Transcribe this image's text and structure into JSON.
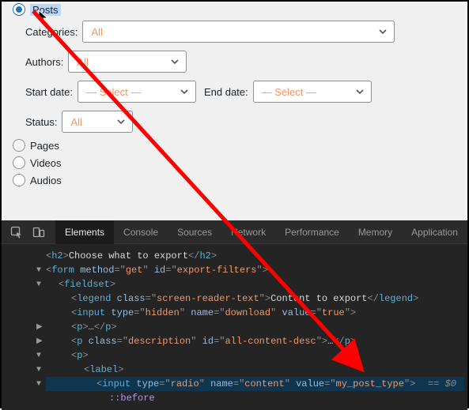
{
  "form": {
    "posts_label": "Posts",
    "categories_label": "Categories:",
    "categories_value": "All",
    "authors_label": "Authors:",
    "authors_value": "All",
    "startdate_label": "Start date:",
    "startdate_value": "— Select —",
    "enddate_label": "End date:",
    "enddate_value": "— Select —",
    "status_label": "Status:",
    "status_value": "All",
    "pages_label": "Pages",
    "videos_label": "Videos",
    "audios_label": "Audios"
  },
  "devtools": {
    "tabs": {
      "elements": "Elements",
      "console": "Console",
      "sources": "Sources",
      "network": "Network",
      "performance": "Performance",
      "memory": "Memory",
      "application": "Application"
    },
    "dom": {
      "h2_text": "Choose what to export",
      "form_method": "get",
      "form_id": "export-filters",
      "legend_class": "screen-reader-text",
      "legend_text": "Content to export",
      "hidden_name": "download",
      "hidden_value": "true",
      "p_collapsed": "…",
      "p_desc_class": "description",
      "p_desc_id": "all-content-desc",
      "radio_type": "radio",
      "radio_name": "content",
      "radio_value": "my_post_type",
      "eq_dollar": " == $0",
      "before": "::before"
    }
  }
}
